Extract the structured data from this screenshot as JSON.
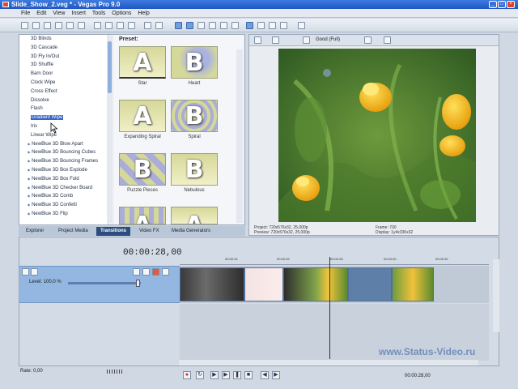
{
  "window": {
    "title": "Slide_Show_2.veg * - Vegas Pro 9.0",
    "controls": [
      "_",
      "□",
      "×"
    ]
  },
  "menu": [
    "File",
    "Edit",
    "View",
    "Insert",
    "Tools",
    "Options",
    "Help"
  ],
  "transitions": {
    "items": [
      "3D Blinds",
      "3D Cascade",
      "3D Fly In/Out",
      "3D Shuffle",
      "Barn Door",
      "Clock Wipe",
      "Cross Effect",
      "Dissolve",
      "Flash",
      "Gradient Wipe",
      "Iris",
      "Linear Wipe"
    ],
    "newblue_items": [
      "NewBlue 3D Blow Apart",
      "NewBlue 3D Bouncing Cubes",
      "NewBlue 3D Bouncing Frames",
      "NewBlue 3D Box Explode",
      "NewBlue 3D Box Fold",
      "NewBlue 3D Checker Board",
      "NewBlue 3D Comb",
      "NewBlue 3D Confetti",
      "NewBlue 3D Flip"
    ],
    "selected": "Gradient Wipe"
  },
  "presets": {
    "title": "Preset:",
    "tiles": [
      {
        "letter": "A",
        "caption": "Star"
      },
      {
        "letter": "B",
        "caption": "Heart"
      },
      {
        "letter": "A",
        "caption": "Expanding Spiral"
      },
      {
        "letter": "B",
        "caption": "Spiral"
      },
      {
        "letter": "B",
        "caption": "Puzzle Pieces"
      },
      {
        "letter": "B",
        "caption": "Nebulous"
      },
      {
        "letter": "A",
        "caption": ""
      },
      {
        "letter": "A",
        "caption": ""
      }
    ]
  },
  "tabs": [
    "Explorer",
    "Project Media",
    "Transitions",
    "Video FX",
    "Media Generators"
  ],
  "active_tab": "Transitions",
  "preview": {
    "quality": "Good (Full)",
    "project": "Project: 720x576x32, 25,000p",
    "preview_info": "Preview: 720x576x32, 25,000p",
    "frame": "Frame: 700",
    "display": "Display: 1y4x336x32"
  },
  "timeline": {
    "time": "00:00:28,00",
    "level": "Level: 100,0 %",
    "ruler": [
      "00:00:24",
      "00:00:26",
      "00:00:28",
      "00:00:30",
      "00:00:32"
    ],
    "rate": "Rate: 0,00",
    "end_time": "00:00:28,00"
  },
  "watermark": "www.Status-Video.ru"
}
